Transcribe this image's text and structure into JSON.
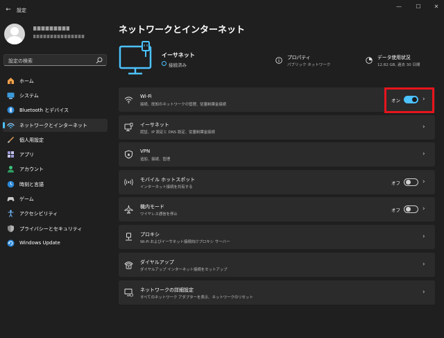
{
  "window": {
    "title": "設定",
    "back_glyph": "←",
    "minimize_glyph": "—",
    "maximize_glyph": "☐",
    "close_glyph": "✕"
  },
  "sidebar": {
    "search_placeholder": "設定の検索",
    "items": [
      {
        "label": "ホーム",
        "icon": "home-icon"
      },
      {
        "label": "システム",
        "icon": "system-icon"
      },
      {
        "label": "Bluetooth とデバイス",
        "icon": "bluetooth-icon"
      },
      {
        "label": "ネットワークとインターネット",
        "icon": "network-icon",
        "active": true
      },
      {
        "label": "個人用設定",
        "icon": "personalization-icon"
      },
      {
        "label": "アプリ",
        "icon": "apps-icon"
      },
      {
        "label": "アカウント",
        "icon": "account-icon"
      },
      {
        "label": "時刻と言語",
        "icon": "time-language-icon"
      },
      {
        "label": "ゲーム",
        "icon": "gaming-icon"
      },
      {
        "label": "アクセシビリティ",
        "icon": "accessibility-icon"
      },
      {
        "label": "プライバシーとセキュリティ",
        "icon": "privacy-security-icon"
      },
      {
        "label": "Windows Update",
        "icon": "windows-update-icon"
      }
    ]
  },
  "main": {
    "title": "ネットワークとインターネット",
    "ethernet": {
      "name": "イーサネット",
      "status": "接続済み"
    },
    "properties": {
      "title": "プロパティ",
      "sub": "パブリック ネットワーク"
    },
    "data_usage": {
      "title": "データ使用状況",
      "sub": "12.82 GB, 過去 30 日間"
    },
    "cards": [
      {
        "title": "Wi-Fi",
        "sub": "接続、既知のネットワークの管理、従量制課金接続",
        "toggle_label": "オン",
        "toggle_on": true
      },
      {
        "title": "イーサネット",
        "sub": "認証、IP 設定と DNS 設定、従量制課金接続"
      },
      {
        "title": "VPN",
        "sub": "追加、接続、管理"
      },
      {
        "title": "モバイル ホットスポット",
        "sub": "インターネット接続を共有する",
        "toggle_label": "オフ",
        "toggle_on": false
      },
      {
        "title": "機内モード",
        "sub": "ワイヤレス通信を停止",
        "toggle_label": "オフ",
        "toggle_on": false
      },
      {
        "title": "プロキシ",
        "sub": "Wi-Fi およびイーサネット接続向けプロキシ サーバー"
      },
      {
        "title": "ダイヤルアップ",
        "sub": "ダイヤルアップ インターネット接続をセットアップ"
      },
      {
        "title": "ネットワークの詳細設定",
        "sub": "すべてのネットワーク アダプターを表示、ネットワークのリセット"
      }
    ]
  },
  "colors": {
    "accent": "#4cc2ff",
    "highlight": "#e8141c",
    "card": "#2b2b2b",
    "background": "#1f1f1f"
  }
}
